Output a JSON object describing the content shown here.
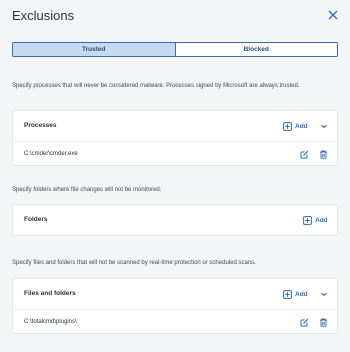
{
  "dialog": {
    "title": "Exclusions"
  },
  "tabs": [
    {
      "label": "Trusted",
      "active": true
    },
    {
      "label": "Blocked",
      "active": false
    }
  ],
  "processes": {
    "description": "Specify processes that will never be considered malware. Processes signed by Microsoft are always trusted.",
    "title": "Processes",
    "add_label": "Add",
    "items": [
      "C:\\cmder\\cmder.exe"
    ]
  },
  "folders": {
    "description": "Specify folders where file changes will not be monitored.",
    "title": "Folders",
    "add_label": "Add"
  },
  "files_and_folders": {
    "description": "Specify files and folders that will not be scanned by real-time protection or scheduled scans.",
    "title": "Files and folders",
    "add_label": "Add",
    "items": [
      "C:\\totalcmd\\plugins\\"
    ]
  },
  "colors": {
    "accent": "#2f6fb3",
    "tab_active_bg": "#c6d9ee",
    "background": "#f4f5f7"
  },
  "icons": [
    "close-icon",
    "add-icon",
    "chevron-down-icon",
    "edit-icon",
    "trash-icon"
  ]
}
